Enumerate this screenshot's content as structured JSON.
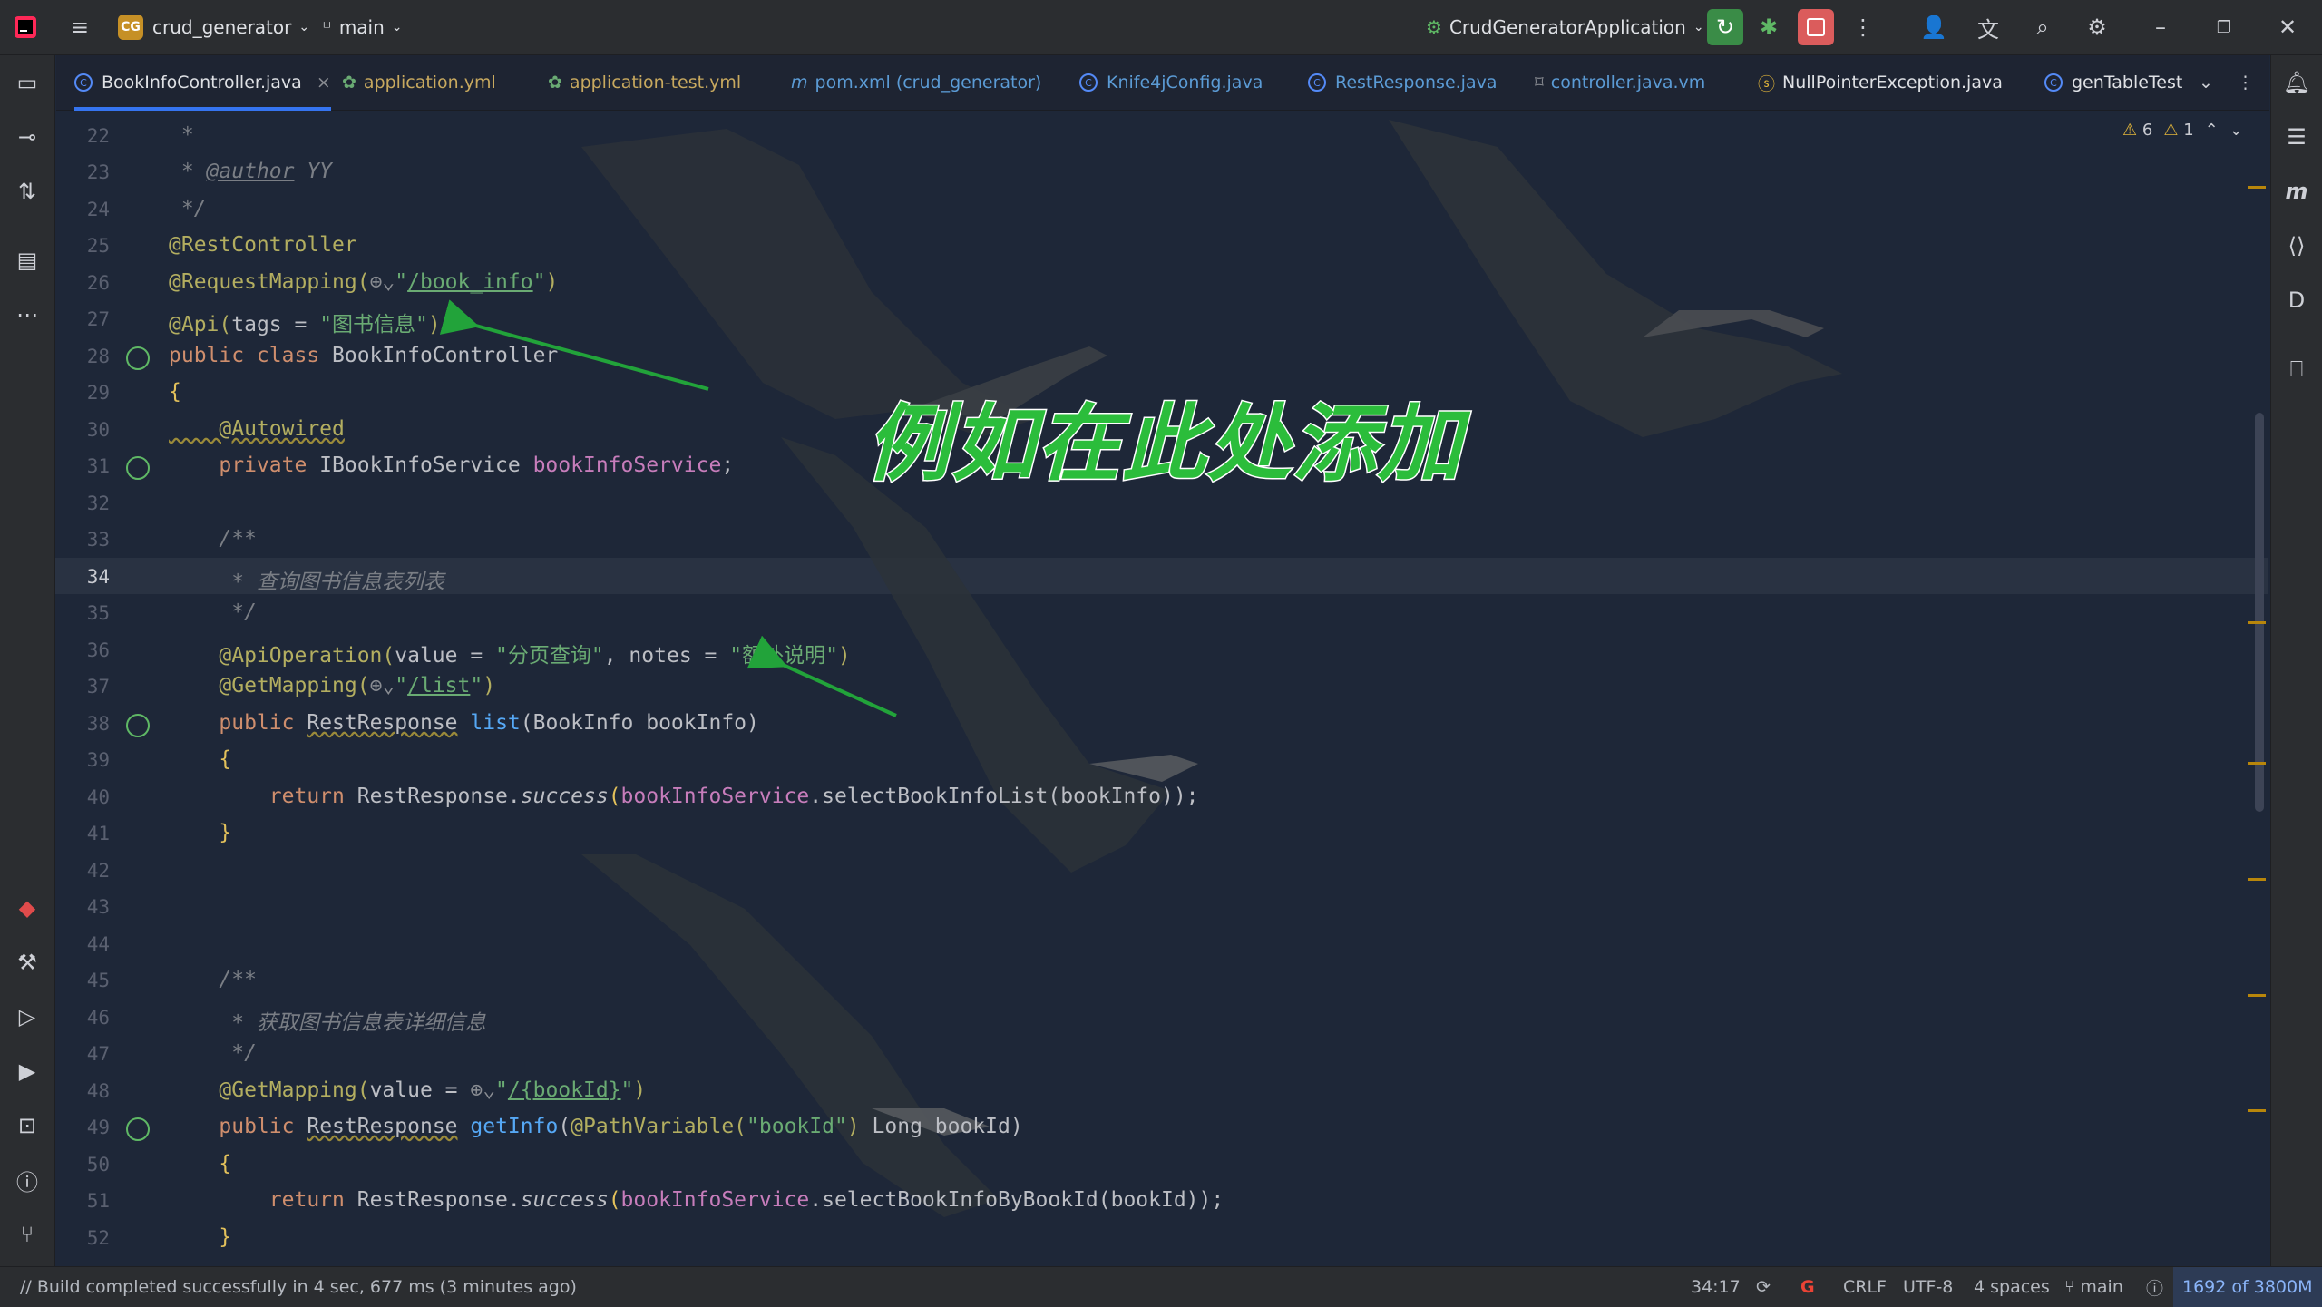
{
  "titlebar": {
    "project_badge": "CG",
    "project_name": "crud_generator",
    "branch": "main",
    "run_config": "CrudGeneratorApplication"
  },
  "tabs": [
    {
      "label": "BookInfoController.java",
      "active": true,
      "close": "×"
    },
    {
      "label": "application.yml"
    },
    {
      "label": "application-test.yml"
    },
    {
      "label": "pom.xml (crud_generator)"
    },
    {
      "label": "Knife4jConfig.java"
    },
    {
      "label": "RestResponse.java"
    },
    {
      "label": "controller.java.vm"
    },
    {
      "label": "NullPointerException.java"
    },
    {
      "label": "genTableTest"
    }
  ],
  "inspections": {
    "warnings": "6",
    "weak_warnings": "1"
  },
  "line_numbers": [
    "22",
    "23",
    "24",
    "25",
    "26",
    "27",
    "28",
    "29",
    "30",
    "31",
    "32",
    "33",
    "34",
    "35",
    "36",
    "37",
    "38",
    "39",
    "40",
    "41",
    "42",
    "43",
    "44",
    "45",
    "46",
    "47",
    "48",
    "49",
    "50",
    "51",
    "52"
  ],
  "current_line": "34",
  "code": {
    "l22": " *",
    "l23_a": " * ",
    "l23_tag": "@author",
    "l23_b": " YY",
    "l24": " */",
    "l25": "@RestController",
    "l26_a": "@RequestMapping(",
    "l26_b": "\"",
    "l26_path": "/book_info",
    "l26_c": "\"",
    "l26_d": ")",
    "l27_a": "@Api(",
    "l27_b": "tags = ",
    "l27_str": "\"图书信息\"",
    "l27_c": ")",
    "l28_kw": "public class",
    "l28_b": " BookInfoController",
    "l29": "{",
    "l30": "    @Autowired",
    "l31_kw": "    private",
    "l31_type": " IBookInfoService ",
    "l31_fld": "bookInfoService",
    "l31_end": ";",
    "l33": "    /**",
    "l34": "     * 查询图书信息表列表",
    "l35": "     */",
    "l36_a": "    @ApiOperation(",
    "l36_b": "value = ",
    "l36_s1": "\"分页查询\"",
    "l36_c": ", notes = ",
    "l36_s2": "\"额外说明\"",
    "l36_d": ")",
    "l37_a": "    @GetMapping(",
    "l37_b": "\"",
    "l37_path": "/list",
    "l37_c": "\"",
    "l37_d": ")",
    "l38_kw": "    public",
    "l38_sp": " ",
    "l38_type": "RestResponse",
    "l38_sp2": " ",
    "l38_fn": "list",
    "l38_params": "(BookInfo bookInfo)",
    "l39": "    {",
    "l40_kw": "        return",
    "l40_a": " RestResponse.",
    "l40_m": "success",
    "l40_b": "(",
    "l40_fld": "bookInfoService",
    "l40_c": ".selectBookInfoList(bookInfo));",
    "l41": "    }",
    "l45": "    /**",
    "l46": "     * 获取图书信息表详细信息",
    "l47": "     */",
    "l48_a": "    @GetMapping(",
    "l48_b": "value = ",
    "l48_q": "\"",
    "l48_path": "/{bookId}",
    "l48_q2": "\"",
    "l48_c": ")",
    "l49_kw": "    public",
    "l49_sp": " ",
    "l49_type": "RestResponse",
    "l49_sp2": " ",
    "l49_fn": "getInfo",
    "l49_a": "(",
    "l49_ann": "@PathVariable(",
    "l49_str": "\"bookId\"",
    "l49_b": ")",
    "l49_c": " Long bookId)",
    "l50": "    {",
    "l51_kw": "        return",
    "l51_a": " RestResponse.",
    "l51_m": "success",
    "l51_b": "(",
    "l51_fld": "bookInfoService",
    "l51_c": ".selectBookInfoByBookId(bookId));",
    "l52": "    }"
  },
  "annotation_text": "例如在此处添加",
  "status": {
    "message": "// Build completed successfully in 4 sec, 677 ms (3 minutes ago)",
    "position": "34:17",
    "line_sep": "CRLF",
    "encoding": "UTF-8",
    "indent": "4 spaces",
    "branch": "main",
    "memory": "1692 of 3800M"
  },
  "colors": {
    "accent": "#3574f0",
    "annotation_green": "#2bbd3b",
    "arrow_green": "#22a33a"
  },
  "icons": [
    "app-logo-icon",
    "hamburger-menu-icon",
    "branch-icon",
    "run-config-icon",
    "rerun-icon",
    "debug-icon",
    "stop-icon",
    "more-icon",
    "add-user-icon",
    "translate-icon",
    "search-icon",
    "settings-icon",
    "minimize-icon",
    "restore-icon",
    "close-icon"
  ]
}
